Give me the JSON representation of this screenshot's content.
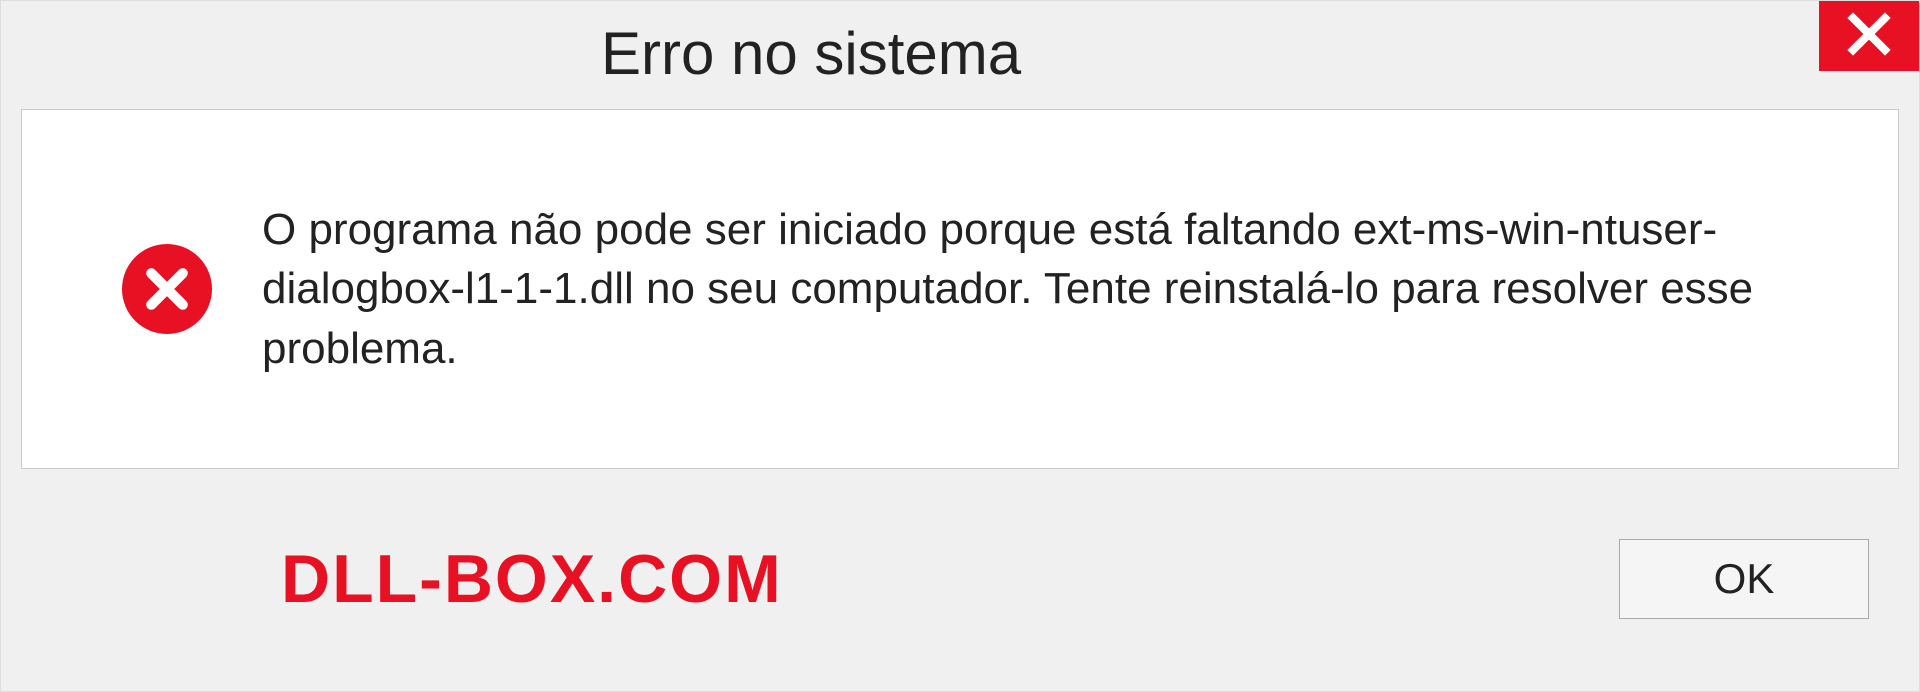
{
  "dialog": {
    "title": "Erro no sistema",
    "message": "O programa não pode ser iniciado porque está faltando ext-ms-win-ntuser-dialogbox-l1-1-1.dll no seu computador. Tente reinstalá-lo para resolver esse problema.",
    "ok_label": "OK"
  },
  "watermark": "DLL-BOX.COM"
}
